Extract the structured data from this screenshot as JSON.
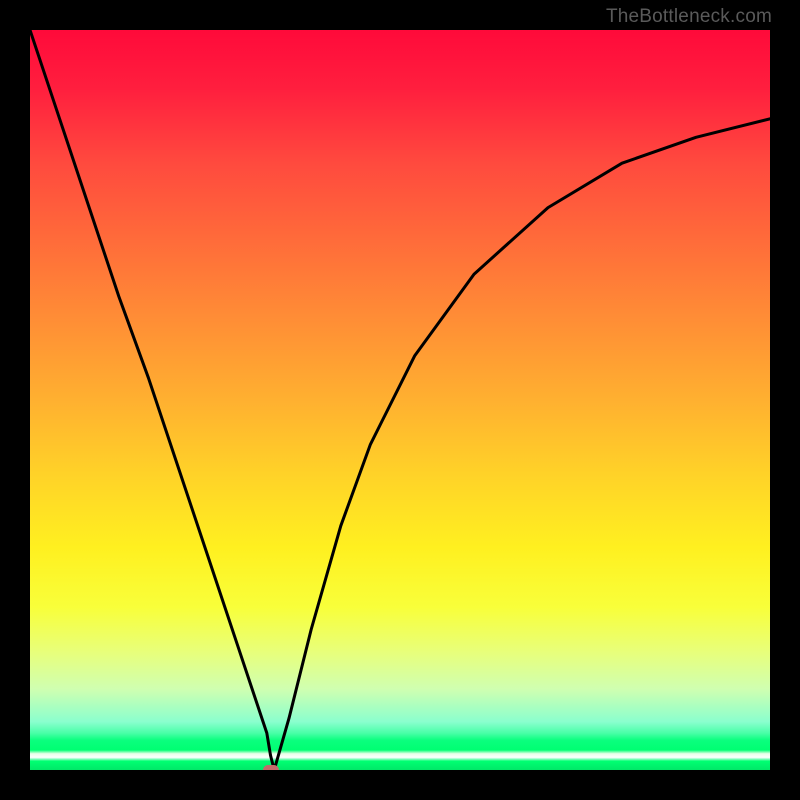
{
  "watermark": "TheBottleneck.com",
  "chart_data": {
    "type": "line",
    "title": "",
    "xlabel": "",
    "ylabel": "",
    "xlim": [
      0,
      100
    ],
    "ylim": [
      0,
      100
    ],
    "grid": false,
    "series": [
      {
        "name": "bottleneck-curve",
        "x": [
          0,
          4,
          8,
          12,
          16,
          20,
          24,
          28,
          30,
          32,
          32.5,
          33,
          35,
          38,
          42,
          46,
          52,
          60,
          70,
          80,
          90,
          100
        ],
        "y": [
          100,
          88,
          76,
          64,
          53,
          41,
          29,
          17,
          11,
          5,
          2,
          0,
          7,
          19,
          33,
          44,
          56,
          67,
          76,
          82,
          85.5,
          88
        ]
      }
    ],
    "marker": {
      "x": 32.5,
      "y": 0,
      "color": "#c56a6a"
    },
    "background_gradient": {
      "stops": [
        {
          "pos": 0.0,
          "color": "#ff0a3a"
        },
        {
          "pos": 0.5,
          "color": "#ffb030"
        },
        {
          "pos": 0.78,
          "color": "#f8ff3a"
        },
        {
          "pos": 0.96,
          "color": "#00ff72"
        },
        {
          "pos": 1.0,
          "color": "#00e868"
        }
      ]
    }
  }
}
